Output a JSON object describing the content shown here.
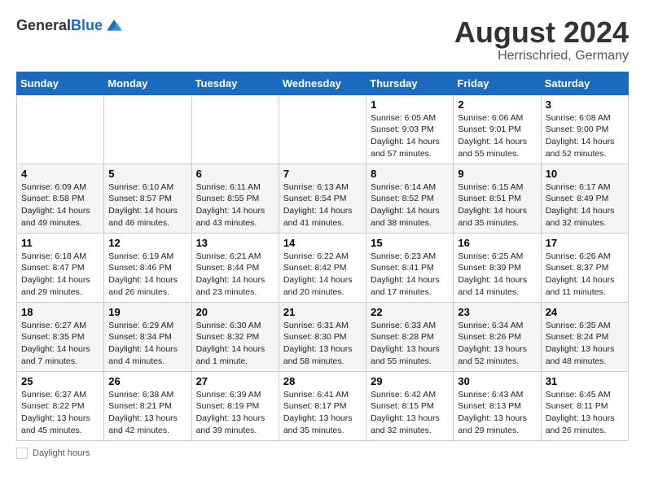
{
  "header": {
    "logo_general": "General",
    "logo_blue": "Blue",
    "month_title": "August 2024",
    "location": "Herrischried, Germany"
  },
  "weekdays": [
    "Sunday",
    "Monday",
    "Tuesday",
    "Wednesday",
    "Thursday",
    "Friday",
    "Saturday"
  ],
  "footer": {
    "label": "Daylight hours"
  },
  "weeks": [
    [
      {
        "day": "",
        "info": ""
      },
      {
        "day": "",
        "info": ""
      },
      {
        "day": "",
        "info": ""
      },
      {
        "day": "",
        "info": ""
      },
      {
        "day": "1",
        "info": "Sunrise: 6:05 AM\nSunset: 9:03 PM\nDaylight: 14 hours\nand 57 minutes."
      },
      {
        "day": "2",
        "info": "Sunrise: 6:06 AM\nSunset: 9:01 PM\nDaylight: 14 hours\nand 55 minutes."
      },
      {
        "day": "3",
        "info": "Sunrise: 6:08 AM\nSunset: 9:00 PM\nDaylight: 14 hours\nand 52 minutes."
      }
    ],
    [
      {
        "day": "4",
        "info": "Sunrise: 6:09 AM\nSunset: 8:58 PM\nDaylight: 14 hours\nand 49 minutes."
      },
      {
        "day": "5",
        "info": "Sunrise: 6:10 AM\nSunset: 8:57 PM\nDaylight: 14 hours\nand 46 minutes."
      },
      {
        "day": "6",
        "info": "Sunrise: 6:11 AM\nSunset: 8:55 PM\nDaylight: 14 hours\nand 43 minutes."
      },
      {
        "day": "7",
        "info": "Sunrise: 6:13 AM\nSunset: 8:54 PM\nDaylight: 14 hours\nand 41 minutes."
      },
      {
        "day": "8",
        "info": "Sunrise: 6:14 AM\nSunset: 8:52 PM\nDaylight: 14 hours\nand 38 minutes."
      },
      {
        "day": "9",
        "info": "Sunrise: 6:15 AM\nSunset: 8:51 PM\nDaylight: 14 hours\nand 35 minutes."
      },
      {
        "day": "10",
        "info": "Sunrise: 6:17 AM\nSunset: 8:49 PM\nDaylight: 14 hours\nand 32 minutes."
      }
    ],
    [
      {
        "day": "11",
        "info": "Sunrise: 6:18 AM\nSunset: 8:47 PM\nDaylight: 14 hours\nand 29 minutes."
      },
      {
        "day": "12",
        "info": "Sunrise: 6:19 AM\nSunset: 8:46 PM\nDaylight: 14 hours\nand 26 minutes."
      },
      {
        "day": "13",
        "info": "Sunrise: 6:21 AM\nSunset: 8:44 PM\nDaylight: 14 hours\nand 23 minutes."
      },
      {
        "day": "14",
        "info": "Sunrise: 6:22 AM\nSunset: 8:42 PM\nDaylight: 14 hours\nand 20 minutes."
      },
      {
        "day": "15",
        "info": "Sunrise: 6:23 AM\nSunset: 8:41 PM\nDaylight: 14 hours\nand 17 minutes."
      },
      {
        "day": "16",
        "info": "Sunrise: 6:25 AM\nSunset: 8:39 PM\nDaylight: 14 hours\nand 14 minutes."
      },
      {
        "day": "17",
        "info": "Sunrise: 6:26 AM\nSunset: 8:37 PM\nDaylight: 14 hours\nand 11 minutes."
      }
    ],
    [
      {
        "day": "18",
        "info": "Sunrise: 6:27 AM\nSunset: 8:35 PM\nDaylight: 14 hours\nand 7 minutes."
      },
      {
        "day": "19",
        "info": "Sunrise: 6:29 AM\nSunset: 8:34 PM\nDaylight: 14 hours\nand 4 minutes."
      },
      {
        "day": "20",
        "info": "Sunrise: 6:30 AM\nSunset: 8:32 PM\nDaylight: 14 hours\nand 1 minute."
      },
      {
        "day": "21",
        "info": "Sunrise: 6:31 AM\nSunset: 8:30 PM\nDaylight: 13 hours\nand 58 minutes."
      },
      {
        "day": "22",
        "info": "Sunrise: 6:33 AM\nSunset: 8:28 PM\nDaylight: 13 hours\nand 55 minutes."
      },
      {
        "day": "23",
        "info": "Sunrise: 6:34 AM\nSunset: 8:26 PM\nDaylight: 13 hours\nand 52 minutes."
      },
      {
        "day": "24",
        "info": "Sunrise: 6:35 AM\nSunset: 8:24 PM\nDaylight: 13 hours\nand 48 minutes."
      }
    ],
    [
      {
        "day": "25",
        "info": "Sunrise: 6:37 AM\nSunset: 8:22 PM\nDaylight: 13 hours\nand 45 minutes."
      },
      {
        "day": "26",
        "info": "Sunrise: 6:38 AM\nSunset: 8:21 PM\nDaylight: 13 hours\nand 42 minutes."
      },
      {
        "day": "27",
        "info": "Sunrise: 6:39 AM\nSunset: 8:19 PM\nDaylight: 13 hours\nand 39 minutes."
      },
      {
        "day": "28",
        "info": "Sunrise: 6:41 AM\nSunset: 8:17 PM\nDaylight: 13 hours\nand 35 minutes."
      },
      {
        "day": "29",
        "info": "Sunrise: 6:42 AM\nSunset: 8:15 PM\nDaylight: 13 hours\nand 32 minutes."
      },
      {
        "day": "30",
        "info": "Sunrise: 6:43 AM\nSunset: 8:13 PM\nDaylight: 13 hours\nand 29 minutes."
      },
      {
        "day": "31",
        "info": "Sunrise: 6:45 AM\nSunset: 8:11 PM\nDaylight: 13 hours\nand 26 minutes."
      }
    ]
  ]
}
